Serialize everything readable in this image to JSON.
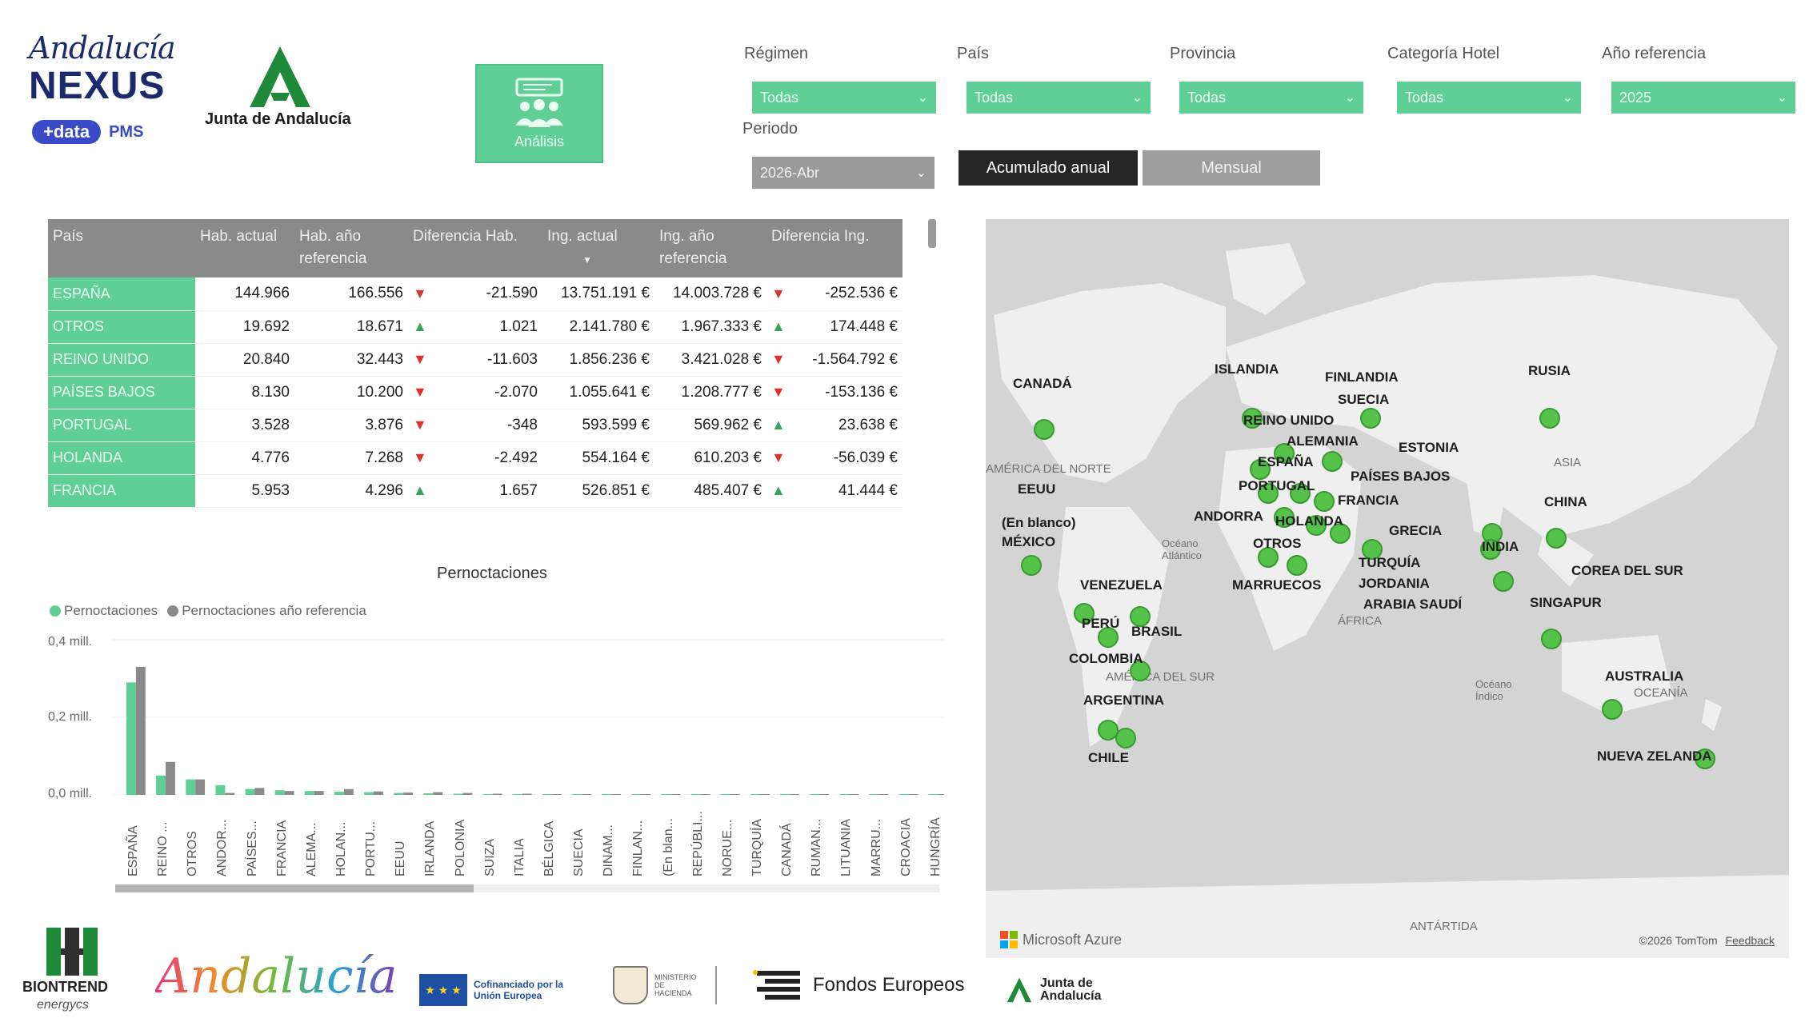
{
  "header": {
    "logo_script": "Andalucía",
    "logo_nexus": "NEXUS",
    "logo_data": "+data",
    "logo_pms": "PMS",
    "junta": "Junta de Andalucía",
    "analisis_label": "Análisis"
  },
  "filters": [
    {
      "label": "Régimen",
      "value": "Todas"
    },
    {
      "label": "País",
      "value": "Todas"
    },
    {
      "label": "Provincia",
      "value": "Todas"
    },
    {
      "label": "Categoría Hotel",
      "value": "Todas"
    },
    {
      "label": "Año referencia",
      "value": "2025"
    }
  ],
  "periodo": {
    "label": "Periodo",
    "value": "2026-Abr"
  },
  "toggle": {
    "acumulado": "Acumulado anual",
    "mensual": "Mensual"
  },
  "table": {
    "headers": [
      "País",
      "Hab. actual",
      "Hab. año referencia",
      "Diferencia Hab.",
      "Ing. actual",
      "Ing. año referencia",
      "Diferencia Ing."
    ],
    "rows": [
      {
        "pais": "ESPAÑA",
        "hab": "144.966",
        "hab_ref": "166.556",
        "dh_trend": "down",
        "dif_hab": "-21.590",
        "ing": "13.751.191 €",
        "ing_ref": "14.003.728 €",
        "di_trend": "down",
        "dif_ing": "-252.536 €"
      },
      {
        "pais": "OTROS",
        "hab": "19.692",
        "hab_ref": "18.671",
        "dh_trend": "up",
        "dif_hab": "1.021",
        "ing": "2.141.780 €",
        "ing_ref": "1.967.333 €",
        "di_trend": "up",
        "dif_ing": "174.448 €"
      },
      {
        "pais": "REINO UNIDO",
        "hab": "20.840",
        "hab_ref": "32.443",
        "dh_trend": "down",
        "dif_hab": "-11.603",
        "ing": "1.856.236 €",
        "ing_ref": "3.421.028 €",
        "di_trend": "down",
        "dif_ing": "-1.564.792 €"
      },
      {
        "pais": "PAÍSES BAJOS",
        "hab": "8.130",
        "hab_ref": "10.200",
        "dh_trend": "down",
        "dif_hab": "-2.070",
        "ing": "1.055.641 €",
        "ing_ref": "1.208.777 €",
        "di_trend": "down",
        "dif_ing": "-153.136 €"
      },
      {
        "pais": "PORTUGAL",
        "hab": "3.528",
        "hab_ref": "3.876",
        "dh_trend": "down",
        "dif_hab": "-348",
        "ing": "593.599 €",
        "ing_ref": "569.962 €",
        "di_trend": "up",
        "dif_ing": "23.638 €"
      },
      {
        "pais": "HOLANDA",
        "hab": "4.776",
        "hab_ref": "7.268",
        "dh_trend": "down",
        "dif_hab": "-2.492",
        "ing": "554.164 €",
        "ing_ref": "610.203 €",
        "di_trend": "down",
        "dif_ing": "-56.039 €"
      },
      {
        "pais": "FRANCIA",
        "hab": "5.953",
        "hab_ref": "4.296",
        "dh_trend": "up",
        "dif_hab": "1.657",
        "ing": "526.851 €",
        "ing_ref": "485.407 €",
        "di_trend": "up",
        "dif_ing": "41.444 €"
      }
    ]
  },
  "chart_data": {
    "type": "bar",
    "title": "Pernoctaciones",
    "series": [
      {
        "name": "Pernoctaciones",
        "color": "#5fcf95",
        "values": [
          0.29,
          0.05,
          0.04,
          0.025,
          0.015,
          0.012,
          0.01,
          0.008,
          0.007,
          0.005,
          0.004,
          0.003,
          0.002,
          0.002,
          0.002,
          0.002,
          0.002,
          0.001,
          0.001,
          0.001,
          0.001,
          0.001,
          0.001,
          0.001,
          0.001,
          0.001,
          0.001,
          0.001
        ]
      },
      {
        "name": "Pernoctaciones año referencia",
        "color": "#8a8a8a",
        "values": [
          0.33,
          0.085,
          0.04,
          0.005,
          0.018,
          0.01,
          0.01,
          0.015,
          0.009,
          0.006,
          0.007,
          0.005,
          0.003,
          0.003,
          0.002,
          0.002,
          0.002,
          0.001,
          0.001,
          0.001,
          0.001,
          0.001,
          0.001,
          0.001,
          0.001,
          0.001,
          0.001,
          0.001
        ]
      }
    ],
    "categories": [
      "ESPAÑA",
      "REINO ...",
      "OTROS",
      "ANDOR...",
      "PAÍSES...",
      "FRANCIA",
      "ALEMA...",
      "HOLAN...",
      "PORTU...",
      "EEUU",
      "IRLANDA",
      "POLONIA",
      "SUIZA",
      "ITALIA",
      "BÉLGICA",
      "SUECIA",
      "DINAM...",
      "FINLAN...",
      "(En blan...",
      "REPÚBLI...",
      "NORUE...",
      "TURQUÍA",
      "CANADÁ",
      "RUMAN...",
      "LITUANIA",
      "MARRU...",
      "CROACIA",
      "HUNGRÍA"
    ],
    "yticks": [
      "0,4 mill.",
      "0,2 mill.",
      "0,0 mill."
    ],
    "ylim": [
      0,
      0.4
    ]
  },
  "map": {
    "labels": [
      "CANADÁ",
      "ISLANDIA",
      "FINLANDIA",
      "RUSIA",
      "SUECIA",
      "REINO UNIDO",
      "ALEMANIA",
      "ESTONIA",
      "ESPAÑA",
      "PAÍSES BAJOS",
      "EEUU",
      "PORTUGAL",
      "FRANCIA",
      "CHINA",
      "ANDORRA",
      "HOLANDA",
      "(En blanco)",
      "GRECIA",
      "MÉXICO",
      "OTROS",
      "INDIA",
      "TURQUÍA",
      "COREA DEL SUR",
      "VENEZUELA",
      "MARRUECOS",
      "JORDANIA",
      "SINGAPUR",
      "ARABIA SAUDÍ",
      "PERÚ",
      "BRASIL",
      "COLOMBIA",
      "AUSTRALIA",
      "ARGENTINA",
      "CHILE",
      "NUEVA ZELANDA"
    ],
    "regions": [
      "AMÉRICA DEL NORTE",
      "ASIA",
      "Océano Atlántico",
      "ÁFRICA",
      "AMÉRICA DEL SUR",
      "Océano Índico",
      "OCEANÍA",
      "ANTÁRTIDA"
    ],
    "attribution": "©2026 TomTom",
    "feedback": "Feedback",
    "provider": "Microsoft Azure"
  },
  "footer": {
    "biontrend": "BIONTREND",
    "biontrend_sub": "energycs",
    "andalucia": "Andalucía",
    "eu_text": "Cofinanciado por la Unión Europea",
    "ministerio": "MINISTERIO DE HACIENDA",
    "fondos": "Fondos Europeos",
    "junta": "Junta de Andalucía"
  }
}
